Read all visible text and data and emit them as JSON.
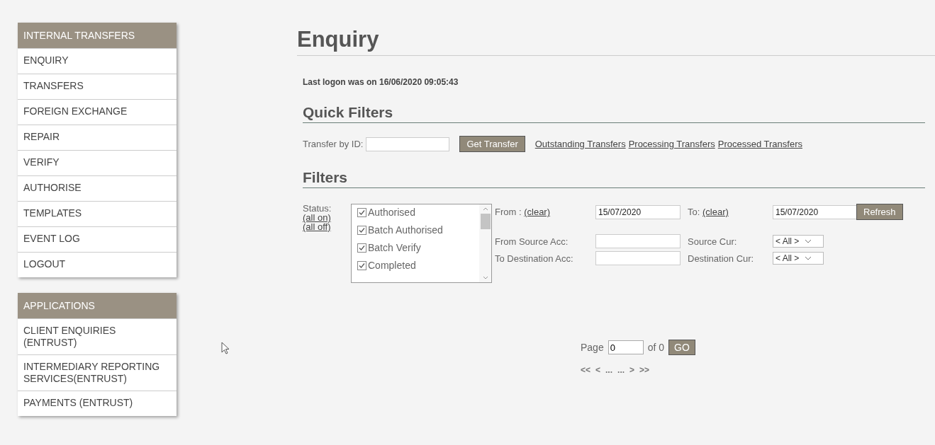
{
  "sidebar": {
    "sections": [
      {
        "title": "INTERNAL TRANSFERS",
        "items": [
          {
            "label": "ENQUIRY"
          },
          {
            "label": "TRANSFERS"
          },
          {
            "label": "FOREIGN EXCHANGE"
          },
          {
            "label": "REPAIR"
          },
          {
            "label": "VERIFY"
          },
          {
            "label": "AUTHORISE"
          },
          {
            "label": "TEMPLATES"
          },
          {
            "label": "EVENT LOG"
          },
          {
            "label": "LOGOUT"
          }
        ]
      },
      {
        "title": "APPLICATIONS",
        "items": [
          {
            "label": "CLIENT ENQUIRIES (ENTRUST)"
          },
          {
            "label": "INTERMEDIARY REPORTING SERVICES(ENTRUST)"
          },
          {
            "label": "PAYMENTS (ENTRUST)"
          }
        ]
      }
    ]
  },
  "page_title": "Enquiry",
  "last_logon": "Last logon was on 16/06/2020 09:05:43",
  "quick_filters": {
    "heading": "Quick Filters",
    "id_label": "Transfer by ID:",
    "button": "Get Transfer",
    "links": [
      "Outstanding Transfers",
      "Processing Transfers",
      "Processed Transfers"
    ]
  },
  "filters": {
    "heading": "Filters",
    "status_label": "Status:",
    "all_on": "(all on)",
    "all_off": "(all off)",
    "statuses": [
      {
        "label": "Authorised",
        "checked": true
      },
      {
        "label": "Batch Authorised",
        "checked": true
      },
      {
        "label": "Batch Verify",
        "checked": true
      },
      {
        "label": "Completed",
        "checked": true
      }
    ],
    "from_label": "From :",
    "from_clear": "(clear)",
    "from_value": "15/07/2020",
    "to_label": "To:",
    "to_clear": "(clear)",
    "to_value": "15/07/2020",
    "refresh": "Refresh",
    "source_acc_label": "From Source Acc:",
    "source_cur_label": "Source Cur:",
    "source_cur_value": "< All >",
    "dest_acc_label": "To Destination Acc:",
    "dest_cur_label": "Destination Cur:",
    "dest_cur_value": "< All >"
  },
  "pagination": {
    "page_label": "Page",
    "page_value": "0",
    "of_label": "of 0",
    "go": "GO",
    "nav": [
      "<<",
      "<",
      "...",
      "...",
      ">",
      ">>"
    ]
  }
}
